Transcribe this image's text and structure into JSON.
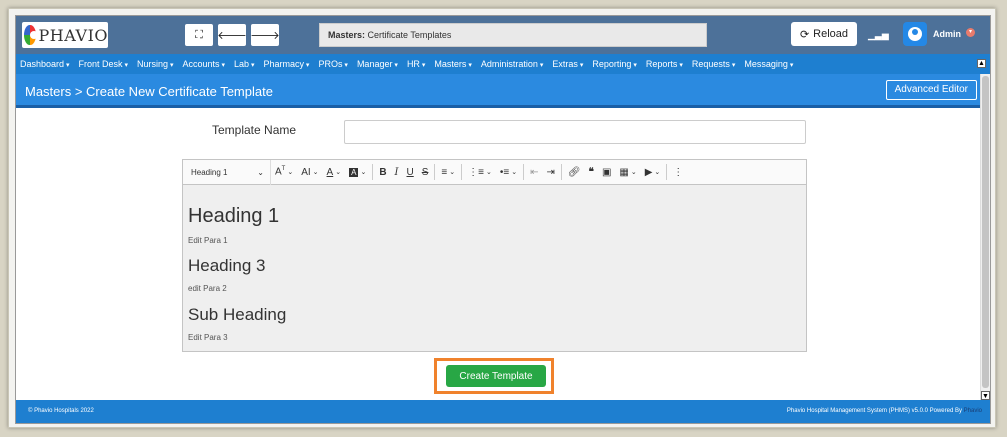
{
  "topbar": {
    "logo_text": "PHAVIO",
    "breadcrumb_label": "Masters:",
    "breadcrumb_value": "Certificate Templates",
    "reload_label": "Reload",
    "user_name": "Admin"
  },
  "nav": {
    "items": [
      {
        "label": "Dashboard"
      },
      {
        "label": "Front Desk"
      },
      {
        "label": "Nursing"
      },
      {
        "label": "Accounts"
      },
      {
        "label": "Lab"
      },
      {
        "label": "Pharmacy"
      },
      {
        "label": "PROs"
      },
      {
        "label": "Manager"
      },
      {
        "label": "HR"
      },
      {
        "label": "Masters"
      },
      {
        "label": "Administration"
      },
      {
        "label": "Extras"
      },
      {
        "label": "Reporting"
      },
      {
        "label": "Reports"
      },
      {
        "label": "Requests"
      },
      {
        "label": "Messaging"
      }
    ]
  },
  "page": {
    "title": "Masters > Create New Certificate Template",
    "advanced_editor_label": "Advanced Editor"
  },
  "form": {
    "template_name_label": "Template Name",
    "template_name_value": "",
    "create_button_label": "Create Template"
  },
  "editor": {
    "heading_select": "Heading 1",
    "colors": {
      "highlight_swatch": "#333333"
    },
    "content": {
      "heading1": "Heading 1",
      "para1": "Edit Para 1",
      "heading3": "Heading 3",
      "para2": "edit Para 2",
      "subheading": "Sub Heading",
      "para3": "Edit Para 3"
    }
  },
  "footer": {
    "copyright": "© Phavio Hospitals 2022",
    "system_text": "Phavio Hospital Management System (PHMS) v5.0.0 Powered By",
    "brand": "Phavio"
  }
}
